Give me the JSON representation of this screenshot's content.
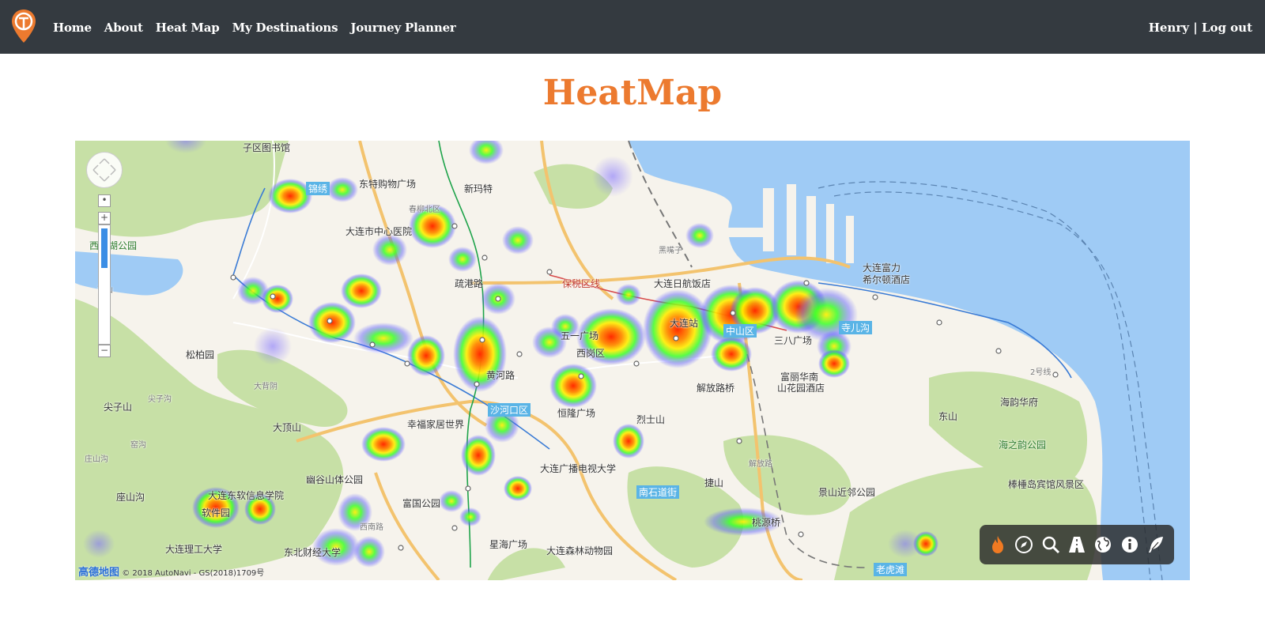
{
  "nav": {
    "items": [
      {
        "label": "Home"
      },
      {
        "label": "About"
      },
      {
        "label": "Heat Map"
      },
      {
        "label": "My Destinations"
      },
      {
        "label": "Journey Planner"
      }
    ],
    "user": "Henry",
    "separator": "|",
    "logout": "Log out"
  },
  "page": {
    "title": "HeatMap"
  },
  "map": {
    "copyright_brand": "高德地图",
    "copyright_text": "© 2018 AutoNavi - GS(2018)1709号",
    "zoom_in": "+",
    "zoom_out": "−",
    "labels": {
      "l1": "子区图书馆",
      "l2": "锦绣",
      "l3": "东特购物广场",
      "l4": "新玛特",
      "l5": "大连市中心医院",
      "l6": "西山湖公园",
      "l7": "黑嘴子",
      "l8": "大连富力",
      "l9": "希尔顿酒店",
      "l10": "大连日航饭店",
      "l11": "保税区线",
      "l12": "疏港路",
      "l13": "五一广场",
      "l14": "西岗区",
      "l15": "大连站",
      "l16": "中山区",
      "l17": "三八广场",
      "l18": "寺儿沟",
      "l19": "松柏园",
      "l20": "黄河路",
      "l21": "富丽华南",
      "l22": "山花园酒店",
      "l23": "解放路桥",
      "l24": "尖子山",
      "l25": "大背阴",
      "l26": "大顶山",
      "l27": "幸福家居世界",
      "l28": "沙河口区",
      "l29": "恒隆广场",
      "l30": "烈士山",
      "l31": "东山",
      "l32": "海韵华府",
      "l33": "海之韵公园",
      "l34": "大连广播电视大学",
      "l35": "幽谷山体公园",
      "l36": "大连东软信息学院",
      "l37": "软件园",
      "l38": "座山沟",
      "l39": "富国公园",
      "l40": "南石道街",
      "l41": "捷山",
      "l42": "景山近邻公园",
      "l43": "棒棰岛宾馆风景区",
      "l44": "桃源桥",
      "l45": "星海广场",
      "l46": "大连森林动物园",
      "l47": "大连理工大学",
      "l48": "东北财经大学",
      "l49": "西山",
      "l50": "西南路",
      "l51": "解放路",
      "l52": "2号线",
      "l53": "尖子沟",
      "l54": "窑沟",
      "l55": "庄山沟",
      "l56": "老虎滩",
      "l57": "春柳北区"
    }
  },
  "colors": {
    "navbar": "#343a40",
    "title": "#ec7a2f",
    "water": "#9fcbf5",
    "park": "#c7e0a6",
    "land": "#f6f3ec",
    "heat_hot": "#ff2a00",
    "heat_mid": "#ffee00",
    "heat_low": "#3cff2a",
    "heat_edge": "#5a5aff"
  },
  "toolbar": {
    "tools": [
      {
        "icon": "fire-icon"
      },
      {
        "icon": "compass-icon"
      },
      {
        "icon": "magnifier-icon"
      },
      {
        "icon": "road-icon"
      },
      {
        "icon": "globe-icon"
      },
      {
        "icon": "info-icon"
      },
      {
        "icon": "feather-icon"
      }
    ]
  }
}
